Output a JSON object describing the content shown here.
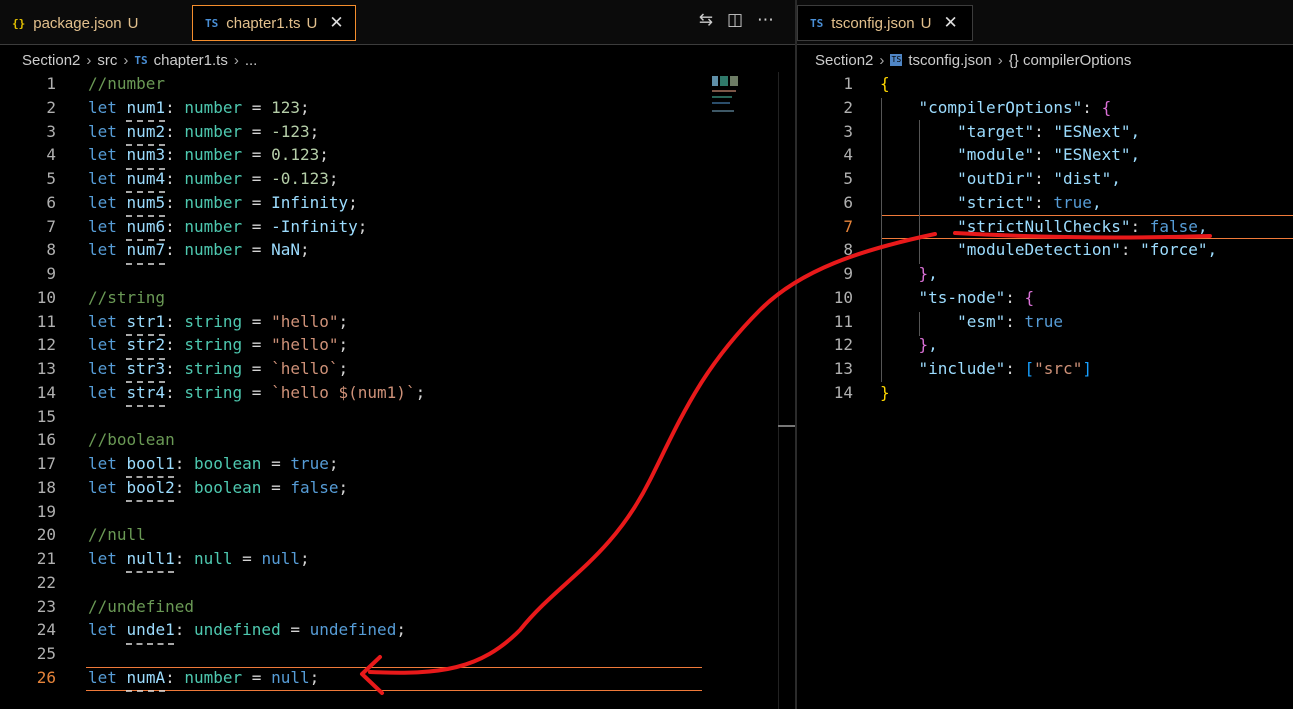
{
  "left_editor": {
    "tabs": [
      {
        "icon": "{}",
        "name": "package.json",
        "status": "U",
        "active": false
      },
      {
        "icon": "TS",
        "name": "chapter1.ts",
        "status": "U",
        "active": true
      }
    ],
    "breadcrumb": [
      "Section2",
      "src",
      "chapter1.ts",
      "..."
    ],
    "lines": [
      {
        "n": "1",
        "text": "//number"
      },
      {
        "n": "2",
        "text": "let num1: number = 123;"
      },
      {
        "n": "3",
        "text": "let num2: number = -123;"
      },
      {
        "n": "4",
        "text": "let num3: number = 0.123;"
      },
      {
        "n": "5",
        "text": "let num4: number = -0.123;"
      },
      {
        "n": "6",
        "text": "let num5: number = Infinity;"
      },
      {
        "n": "7",
        "text": "let num6: number = -Infinity;"
      },
      {
        "n": "8",
        "text": "let num7: number = NaN;"
      },
      {
        "n": "9",
        "text": ""
      },
      {
        "n": "10",
        "text": "//string"
      },
      {
        "n": "11",
        "text": "let str1: string = \"hello\";"
      },
      {
        "n": "12",
        "text": "let str2: string = \"hello\";"
      },
      {
        "n": "13",
        "text": "let str3: string = `hello`;"
      },
      {
        "n": "14",
        "text": "let str4: string = `hello $(num1)`;"
      },
      {
        "n": "15",
        "text": ""
      },
      {
        "n": "16",
        "text": "//boolean"
      },
      {
        "n": "17",
        "text": "let bool1: boolean = true;"
      },
      {
        "n": "18",
        "text": "let bool2: boolean = false;"
      },
      {
        "n": "19",
        "text": ""
      },
      {
        "n": "20",
        "text": "//null"
      },
      {
        "n": "21",
        "text": "let null1: null = null;"
      },
      {
        "n": "22",
        "text": ""
      },
      {
        "n": "23",
        "text": "//undefined"
      },
      {
        "n": "24",
        "text": "let unde1: undefined = undefined;"
      },
      {
        "n": "25",
        "text": ""
      },
      {
        "n": "26",
        "text": "let numA: number = null;"
      }
    ]
  },
  "right_editor": {
    "tabs": [
      {
        "icon": "TS",
        "name": "tsconfig.json",
        "status": "U",
        "active": true
      }
    ],
    "breadcrumb": [
      "Section2",
      "tsconfig.json",
      "{} compilerOptions"
    ],
    "lines": [
      {
        "n": "1",
        "text": "{"
      },
      {
        "n": "2",
        "text": "    \"compilerOptions\": {"
      },
      {
        "n": "3",
        "text": "        \"target\": \"ESNext\","
      },
      {
        "n": "4",
        "text": "        \"module\": \"ESNext\","
      },
      {
        "n": "5",
        "text": "        \"outDir\": \"dist\","
      },
      {
        "n": "6",
        "text": "        \"strict\": true,"
      },
      {
        "n": "7",
        "text": "        \"strictNullChecks\": false,"
      },
      {
        "n": "8",
        "text": "        \"moduleDetection\": \"force\","
      },
      {
        "n": "9",
        "text": "    },"
      },
      {
        "n": "10",
        "text": "    \"ts-node\": {"
      },
      {
        "n": "11",
        "text": "        \"esm\": true"
      },
      {
        "n": "12",
        "text": "    },"
      },
      {
        "n": "13",
        "text": "    \"include\": [\"src\"]"
      },
      {
        "n": "14",
        "text": "}"
      }
    ]
  },
  "colors": {
    "active_tab_border": "#f58e2d",
    "annotation": "#e8191a",
    "current_line_highlight": "#f07a3a"
  }
}
